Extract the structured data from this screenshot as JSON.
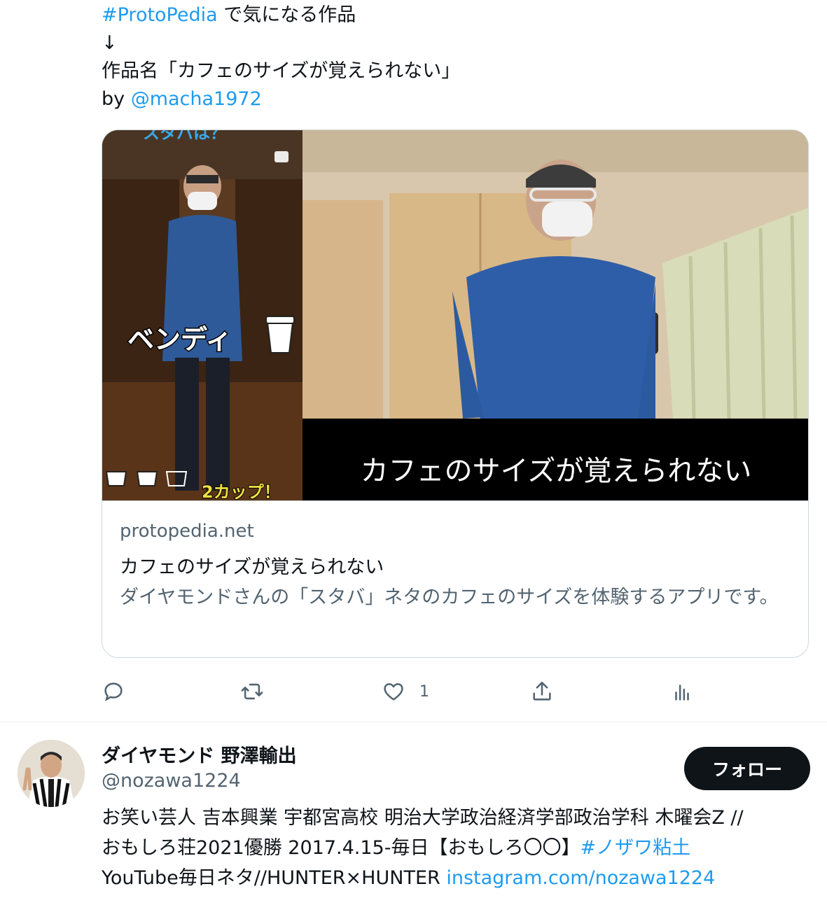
{
  "tweet": {
    "hashtag": "#ProtoPedia",
    "line1_rest": " で気になる作品",
    "arrow": "↓",
    "work_line": "作品名「カフェのサイズが覚えられない」",
    "by_prefix": "by ",
    "author_mention": "@macha1972"
  },
  "card": {
    "image": {
      "left_top_caption": "スタバは？",
      "left_caption": "ベンディ",
      "left_bottom_caption": "2カップ！",
      "banner_text": "カフェのサイズが覚えられない"
    },
    "domain": "protopedia.net",
    "title": "カフェのサイズが覚えられない",
    "description": "ダイヤモンドさんの「スタバ」ネタのカフェのサイズを体験するアプリです。"
  },
  "actions": {
    "reply_icon": "reply-icon",
    "retweet_icon": "retweet-icon",
    "like_icon": "heart-icon",
    "like_count": "1",
    "share_icon": "share-icon",
    "analytics_icon": "analytics-icon"
  },
  "user": {
    "display_name": "ダイヤモンド 野澤輸出",
    "handle": "@nozawa1224",
    "follow_label": "フォロー",
    "bio_line1": "お笑い芸人 吉本興業 宇都宮高校 明治大学政治経済学部政治学科 木曜会Z //",
    "bio_line2_text": "おもしろ荘2021優勝 2017.4.15-毎日【おもしろ〇〇】",
    "bio_line2_hashtag": "#ノザワ粘土",
    "bio_line3_text": "YouTube毎日ネタ//HUNTER×HUNTER ",
    "bio_line3_link": "instagram.com/nozawa1224"
  },
  "colors": {
    "link": "#1d9bf0",
    "text": "#0f1419",
    "secondary": "#536471",
    "border": "#cfd9de",
    "button_bg": "#0f1419"
  }
}
